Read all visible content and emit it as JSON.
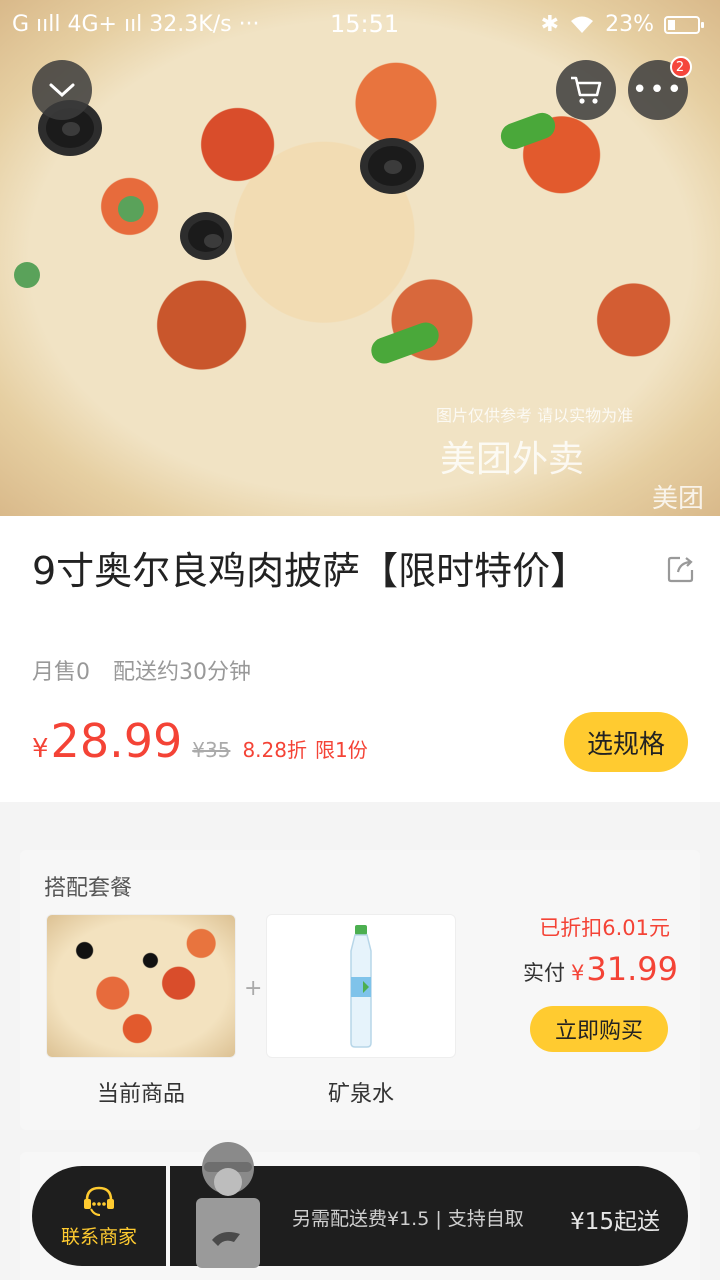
{
  "status_bar": {
    "left": "G ııll 4G+ ııl 32.3K/s ···",
    "time": "15:51",
    "battery": "23%"
  },
  "hero": {
    "watermark_small": "图片仅供参考 请以实物为准",
    "watermark_brand": "美团外卖",
    "watermark_corner": "美团"
  },
  "header": {
    "cart_badge": "2"
  },
  "product": {
    "title": "9寸奥尔良鸡肉披萨【限时特价】",
    "monthly_sales": "月售0",
    "delivery_time": "配送约30分钟",
    "currency": "¥",
    "price": "28.99",
    "original_price": "¥35",
    "discount": "8.28折",
    "limit": "限1份",
    "select_spec_label": "选规格"
  },
  "combo": {
    "title": "搭配套餐",
    "item1_label": "当前商品",
    "item2_label": "矿泉水",
    "plus": "+",
    "saved_text": "已折扣6.01元",
    "pay_label": "实付",
    "pay_currency": "¥",
    "pay_value": "31.99",
    "buy_label": "立即购买"
  },
  "bottom_bar": {
    "contact_label": "联系商家",
    "delivery_fee_text": "另需配送费¥1.5 | 支持自取",
    "min_order_text": "¥15起送"
  },
  "colors": {
    "accent_yellow": "#ffcb30",
    "price_red": "#f44336",
    "bar_dark": "#1e1e1e"
  }
}
